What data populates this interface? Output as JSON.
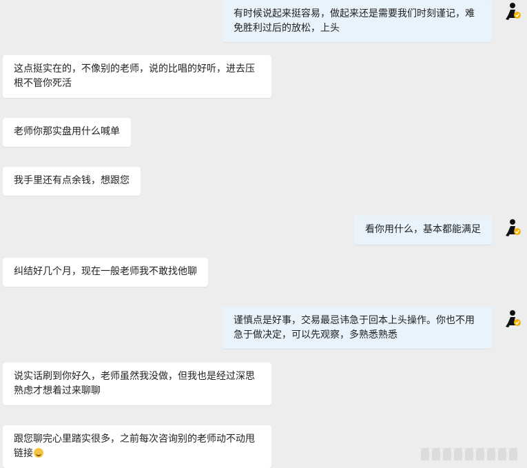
{
  "messages": [
    {
      "side": "out",
      "text": "有时候说起来挺容易，做起来还是需要我们时刻谨记，难免胜利过后的放松，上头"
    },
    {
      "side": "in",
      "text": "这点挺实在的，不像别的老师，说的比唱的好听，进去压根不管你死活"
    },
    {
      "side": "in",
      "text": "老师你那实盘用什么喊单"
    },
    {
      "side": "in",
      "text": "我手里还有点余钱，想跟您"
    },
    {
      "side": "out",
      "text": "看你用什么，基本都能满足"
    },
    {
      "side": "in",
      "text": "纠结好几个月，现在一般老师我不敢找他聊"
    },
    {
      "side": "out",
      "text": "谨慎点是好事，交易最忌讳急于回本上头操作。你也不用急于做决定，可以先观察，多熟悉熟悉"
    },
    {
      "side": "in",
      "text": "说实话刷到你好久，老师虽然我没做，但我也是经过深思熟虑才想着过来聊聊"
    },
    {
      "side": "in",
      "text": "跟您聊完心里踏实很多，之前每次咨询别的老师动不动甩链接"
    }
  ],
  "colors": {
    "background": "#ededed",
    "incoming_bubble": "#ffffff",
    "outgoing_bubble": "#e9f3fc",
    "avatar_badge": "#f5b100"
  },
  "icons": {
    "avatar": "person-silhouette-avatar-icon",
    "emoji": "grin-emoji-icon"
  }
}
